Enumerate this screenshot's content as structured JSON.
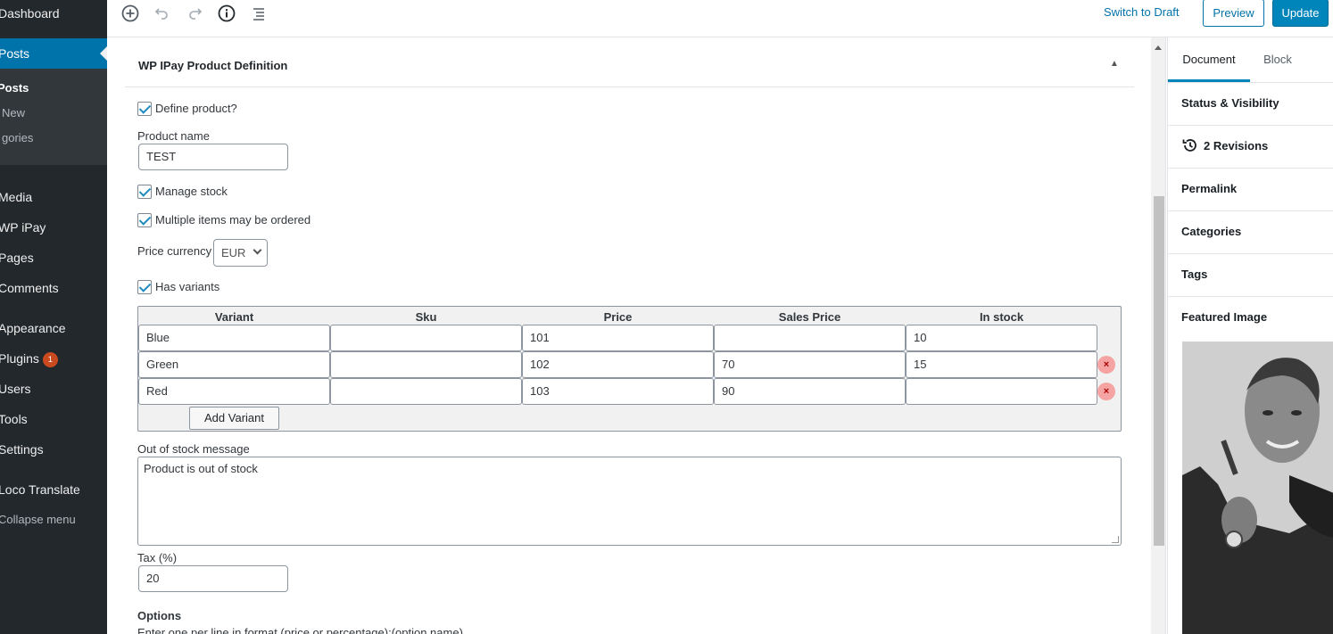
{
  "sidebar": {
    "items": [
      {
        "label": "Dashboard"
      },
      {
        "label": "Posts"
      },
      {
        "label": "Media"
      },
      {
        "label": "WP iPay"
      },
      {
        "label": "Pages"
      },
      {
        "label": "Comments"
      },
      {
        "label": "Appearance"
      },
      {
        "label": "Plugins",
        "badge": "1"
      },
      {
        "label": "Users"
      },
      {
        "label": "Tools"
      },
      {
        "label": "Settings"
      },
      {
        "label": "Loco Translate"
      }
    ],
    "submenu": [
      {
        "label": "Posts"
      },
      {
        "label": "New"
      },
      {
        "label": "gories"
      }
    ],
    "collapse": "Collapse menu",
    "active_color": "#0073aa"
  },
  "toolbar": {
    "icons": [
      "add-block-icon",
      "undo-icon",
      "redo-icon",
      "info-icon",
      "outline-icon"
    ],
    "switch_to_draft": "Switch to Draft",
    "preview": "Preview",
    "update": "Update"
  },
  "metabox": {
    "title": "WP IPay Product Definition",
    "define_product": "Define product?",
    "product_name_label": "Product name",
    "product_name_value": "TEST",
    "manage_stock": "Manage stock",
    "multiple_items": "Multiple items may be ordered",
    "price_currency_label": "Price currency",
    "price_currency_value": "EUR",
    "has_variants": "Has variants",
    "variants": {
      "headers": [
        "Variant",
        "Sku",
        "Price",
        "Sales Price",
        "In stock"
      ],
      "rows": [
        [
          "Blue",
          "",
          "101",
          "",
          "10"
        ],
        [
          "Green",
          "",
          "102",
          "70",
          "15"
        ],
        [
          "Red",
          "",
          "103",
          "90",
          ""
        ]
      ],
      "add_label": "Add Variant"
    },
    "out_of_stock_label": "Out of stock message",
    "out_of_stock_value": "Product is out of stock",
    "tax_label": "Tax (%)",
    "tax_value": "20",
    "options_label": "Options",
    "options_hint": "Enter one per line in format (price or percentage):(option name)"
  },
  "settings": {
    "tab_document": "Document",
    "tab_block": "Block",
    "panels": [
      "Status & Visibility",
      "2 Revisions",
      "Permalink",
      "Categories",
      "Tags",
      "Featured Image"
    ]
  }
}
